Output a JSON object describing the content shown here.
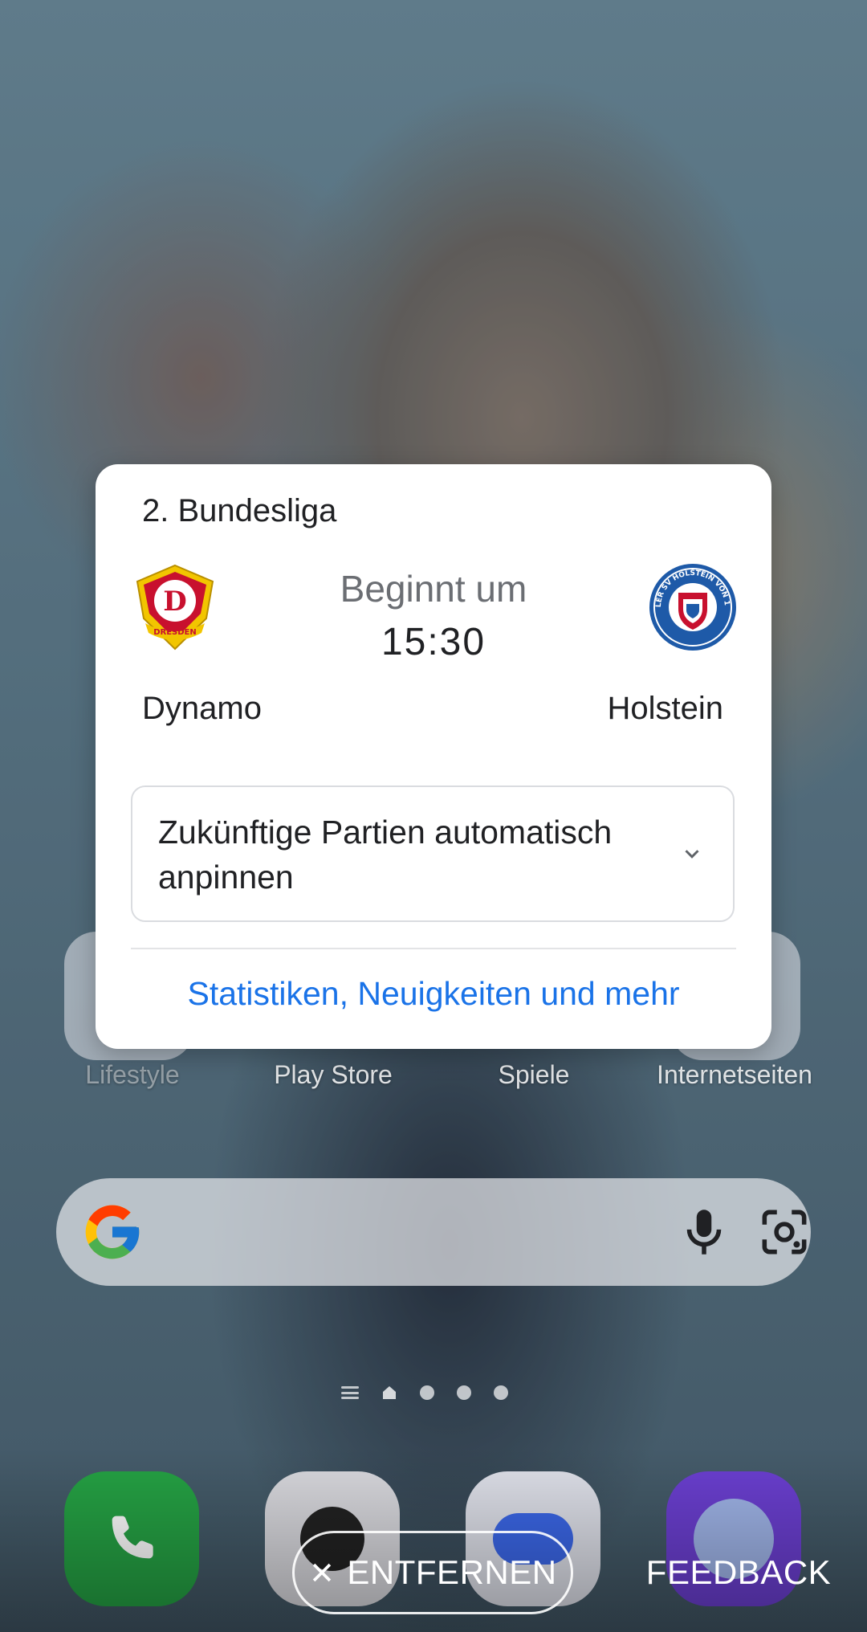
{
  "card": {
    "league": "2. Bundesliga",
    "status": "Beginnt um",
    "time": "15:30",
    "home_team": "Dynamo",
    "away_team": "Holstein",
    "home_crest_text": "DRESDEN",
    "away_crest_text": "KIELER SV HOLSTEIN VON 1900",
    "pin_option": "Zukünftige Partien automatisch anpinnen",
    "more_link": "Statistiken, Neuigkeiten und mehr"
  },
  "home": {
    "app_labels": [
      "Lifestyle",
      "Play Store",
      "Spiele",
      "Internetseiten"
    ],
    "page_count": 4,
    "current_page": 1
  },
  "bottom_bar": {
    "remove_label": "ENTFERNEN",
    "feedback_label": "FEEDBACK"
  },
  "colors": {
    "link": "#1a73e8",
    "card_bg": "#ffffff",
    "phone_green": "#25a244",
    "browser_purple": "#6b3fd1"
  },
  "icons": {
    "search": "google-g-icon",
    "voice": "mic-icon",
    "lens": "camera-lens-icon",
    "dismiss": "close-icon",
    "expand": "chevron-down-icon"
  }
}
